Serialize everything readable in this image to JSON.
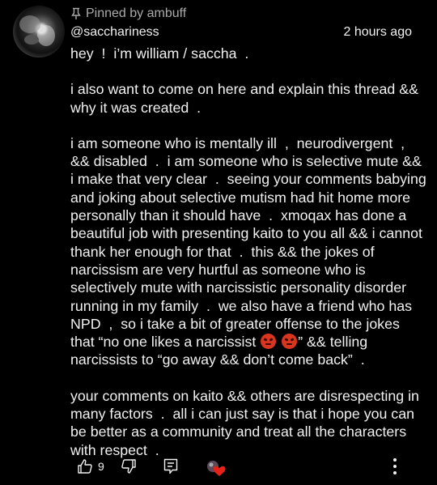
{
  "comment": {
    "pinned_label": "Pinned by ambuff",
    "author": "@sacchariness",
    "timestamp": "2 hours ago",
    "paragraphs": [
      "hey  !  i’m william / saccha  .",
      "i also want to come on here and explain this thread && why it was created  .",
      "i am someone who is mentally ill  ,  neurodivergent  ,  && disabled  .  i am someone who is selective mute && i make that very clear  .  seeing your comments babying and joking about selective mutism had hit home more personally than it should have  .  xmoqax has done a beautiful job with presenting kaito to you all && i cannot thank her enough for that  .  this && the jokes of narcissism are very hurtful as someone who is selectively mute with narcissistic personality disorder running in my family  .  we also have a friend who has NPD  ,  so i take a bit of greater offense to the jokes that “no one likes a narcissist ",
      "” && telling narcissists to “go away && don’t come back”  .",
      "your comments on kaito && others are disrespecting in many factors  .  all i can just say is that i hope you can be better as a community and treat all the characters with respect  ."
    ],
    "emoji_name": "angry-face-emoji",
    "like_count": "9",
    "icons": {
      "pin": "pin-icon",
      "like": "thumbs-up-icon",
      "dislike": "thumbs-down-icon",
      "reply": "reply-icon",
      "creator_heart": "creator-heart-icon",
      "more": "more-vertical-icon"
    },
    "colors": {
      "background": "#000000",
      "text": "#f1f1f1",
      "secondary_text": "#aaaaaa",
      "heart": "#e62117"
    }
  }
}
